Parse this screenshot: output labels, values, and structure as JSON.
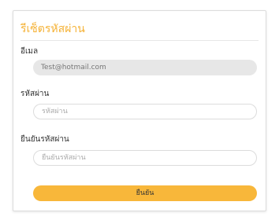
{
  "form": {
    "title": "รีเซ็ตรหัสผ่าน",
    "email": {
      "label": "อีเมล",
      "value": "Test@hotmail.com"
    },
    "password": {
      "label": "รหัสผ่าน",
      "placeholder": "รหัสผ่าน"
    },
    "confirm_password": {
      "label": "ยืนยันรหัสผ่าน",
      "placeholder": "ยืนยันรหัสผ่าน"
    },
    "submit_label": "ยืนยัน"
  },
  "colors": {
    "accent": "#f8b73a",
    "title": "#f5b236",
    "readonly_bg": "#e7e7e7"
  }
}
